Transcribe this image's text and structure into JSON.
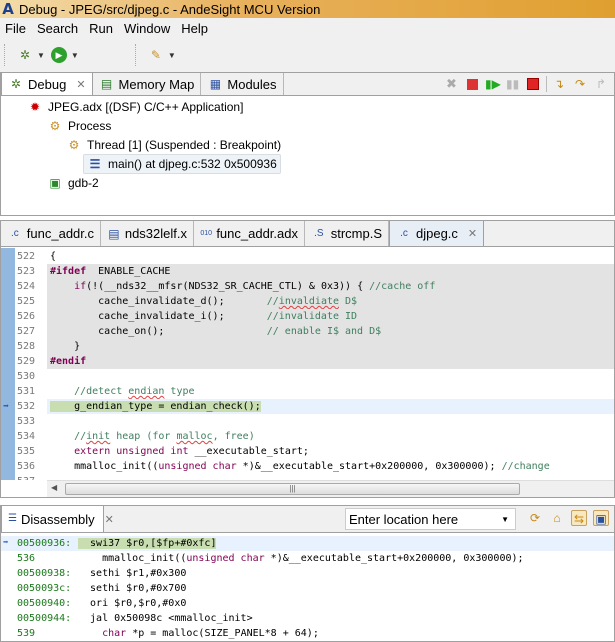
{
  "window": {
    "title": "Debug - JPEG/src/djpeg.c - AndeSight MCU Version",
    "logo": "A"
  },
  "menu": [
    "File",
    "Search",
    "Run",
    "Window",
    "Help"
  ],
  "toolbar": [
    "debug-icon",
    "run-icon",
    "external-tools-icon"
  ],
  "debug_view": {
    "tabs": [
      {
        "label": "Debug",
        "icon": "debug-icon",
        "active": true
      },
      {
        "label": "Memory Map",
        "icon": "memory-icon"
      },
      {
        "label": "Modules",
        "icon": "modules-icon"
      }
    ],
    "actions": [
      "remove-terminated-icon",
      "resume-icon",
      "resume-all-icon",
      "suspend-icon",
      "terminate-icon",
      "step-into-icon",
      "step-over-icon",
      "step-return-icon"
    ],
    "tree": [
      {
        "label": "JPEG.adx [(DSF) C/C++ Application]",
        "icon": "bug-icon",
        "level": 0
      },
      {
        "label": "Process",
        "icon": "process-icon",
        "level": 1
      },
      {
        "label": "Thread [1] (Suspended : Breakpoint)",
        "icon": "thread-icon",
        "level": 2
      },
      {
        "label": "main() at djpeg.c:532 0x500936",
        "icon": "stack-frame-icon",
        "level": 3,
        "selected": true
      },
      {
        "label": "gdb-2",
        "icon": "gdb-icon",
        "level": 1
      }
    ]
  },
  "editor": {
    "tabs": [
      {
        "label": "func_addr.c",
        "icon": "c-file-icon"
      },
      {
        "label": "nds32lelf.x",
        "icon": "text-file-icon"
      },
      {
        "label": "func_addr.adx",
        "icon": "binary-file-icon"
      },
      {
        "label": "strcmp.S",
        "icon": "asm-file-icon"
      },
      {
        "label": "djpeg.c",
        "icon": "c-file-icon",
        "active": true
      }
    ],
    "lines": [
      {
        "n": "522",
        "t": [
          [
            "",
            "{"
          ]
        ]
      },
      {
        "n": "523",
        "g": 1,
        "t": [
          [
            "pp",
            "#ifdef"
          ],
          [
            "",
            "  ENABLE_CACHE"
          ]
        ]
      },
      {
        "n": "524",
        "g": 1,
        "t": [
          [
            "",
            "    "
          ],
          [
            "kw",
            "if"
          ],
          [
            "",
            "(!(__nds32__mfsr(NDS32_SR_CACHE_CTL) & 0x3)) { "
          ],
          [
            "cm",
            "//cache off"
          ]
        ]
      },
      {
        "n": "525",
        "g": 1,
        "t": [
          [
            "",
            "        cache_invalidate_d();       "
          ],
          [
            "cm",
            "//"
          ],
          [
            "cm sq",
            "invaldiate"
          ],
          [
            "cm",
            " D$"
          ]
        ]
      },
      {
        "n": "526",
        "g": 1,
        "t": [
          [
            "",
            "        cache_invalidate_i();       "
          ],
          [
            "cm",
            "//invalidate ID"
          ]
        ]
      },
      {
        "n": "527",
        "g": 1,
        "t": [
          [
            "",
            "        cache_on();                 "
          ],
          [
            "cm",
            "// enable I$ and D$"
          ]
        ]
      },
      {
        "n": "528",
        "g": 1,
        "t": [
          [
            "",
            "    }"
          ]
        ]
      },
      {
        "n": "529",
        "g": 1,
        "t": [
          [
            "pp",
            "#endif"
          ]
        ]
      },
      {
        "n": "530",
        "t": []
      },
      {
        "n": "531",
        "t": [
          [
            "cm",
            "    //detect "
          ],
          [
            "cm sq",
            "endian"
          ],
          [
            "cm",
            " type"
          ]
        ]
      },
      {
        "n": "532",
        "cur": 1,
        "t": [
          [
            "curhl",
            "    g_endian_type = endian_check();"
          ]
        ]
      },
      {
        "n": "533",
        "t": []
      },
      {
        "n": "534",
        "t": [
          [
            "cm",
            "    //"
          ],
          [
            "cm sq",
            "init"
          ],
          [
            "cm",
            " heap (for "
          ],
          [
            "cm sq",
            "malloc"
          ],
          [
            "cm",
            ", free)"
          ]
        ]
      },
      {
        "n": "535",
        "t": [
          [
            "",
            "    "
          ],
          [
            "kw",
            "extern unsigned int"
          ],
          [
            "",
            " __executable_start;"
          ]
        ]
      },
      {
        "n": "536",
        "t": [
          [
            "",
            "    mmalloc_init(("
          ],
          [
            "kw",
            "unsigned char"
          ],
          [
            "",
            " *)&__executable_start+0x200000, 0x300000); "
          ],
          [
            "cm",
            "//change"
          ]
        ]
      },
      {
        "n": "537",
        "t": []
      }
    ]
  },
  "disassembly": {
    "tab": "Disassembly",
    "location_placeholder": "Enter location here",
    "lines": [
      {
        "a": "00500936:",
        "cur": 1,
        "t": [
          [
            "curhl",
            "  swi37 $r0,[$fp+#0xfc]"
          ]
        ]
      },
      {
        "a": "536",
        "t": [
          [
            "",
            "    mmalloc_init(("
          ],
          [
            "kw",
            "unsigned char"
          ],
          [
            "",
            " *)&__executable_start+0x200000, 0x300000);"
          ]
        ]
      },
      {
        "a": "00500938:",
        "t": [
          [
            "",
            "  sethi $r1,#0x300"
          ]
        ]
      },
      {
        "a": "0050093c:",
        "t": [
          [
            "",
            "  sethi $r0,#0x700"
          ]
        ]
      },
      {
        "a": "00500940:",
        "t": [
          [
            "",
            "  ori $r0,$r0,#0x0"
          ]
        ]
      },
      {
        "a": "00500944:",
        "t": [
          [
            "",
            "  jal 0x50098c <mmalloc_init>"
          ]
        ]
      },
      {
        "a": "539",
        "t": [
          [
            "",
            "    "
          ],
          [
            "kw",
            "char"
          ],
          [
            "",
            " *p = malloc(SIZE_PANEL*8 + 64);"
          ]
        ]
      }
    ]
  }
}
